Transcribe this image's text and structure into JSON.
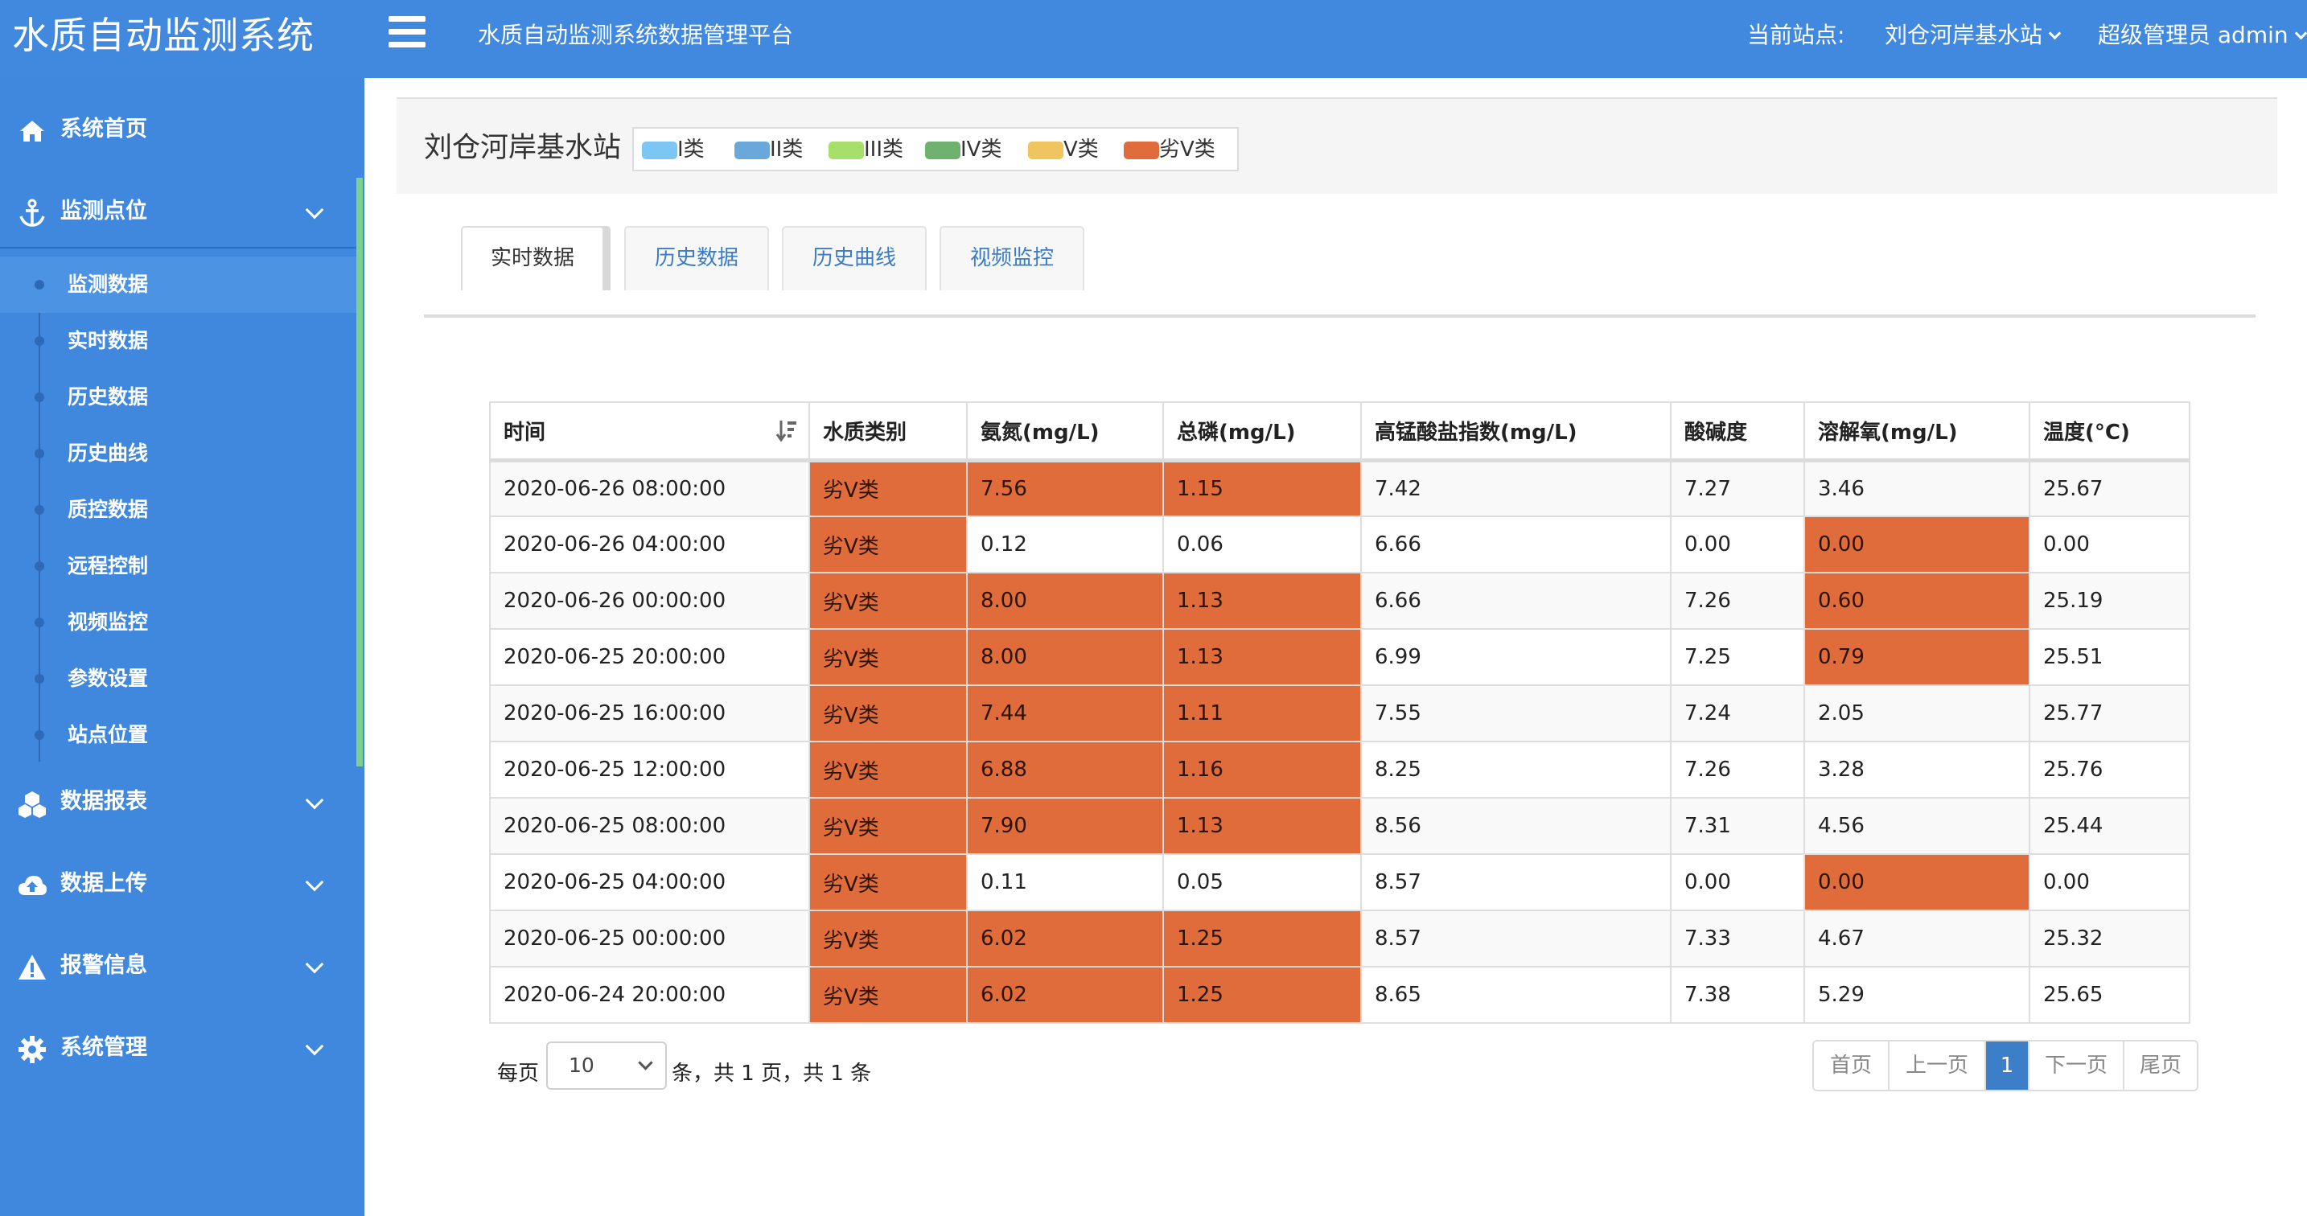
{
  "app": {
    "brand": "水质自动监测系统",
    "platform": "水质自动监测系统数据管理平台",
    "current_site_label": "当前站点:",
    "current_site": "刘仓河岸基水站",
    "user": "超级管理员 admin"
  },
  "sidebar": {
    "menu": [
      {
        "label": "系统首页",
        "icon": "home-icon"
      },
      {
        "label": "监测点位",
        "icon": "anchor-icon"
      },
      {
        "label": "数据报表",
        "icon": "cubes-icon"
      },
      {
        "label": "数据上传",
        "icon": "cloud-upload-icon"
      },
      {
        "label": "报警信息",
        "icon": "warning-icon"
      },
      {
        "label": "系统管理",
        "icon": "gear-icon"
      }
    ],
    "sub_items": [
      "监测数据",
      "实时数据",
      "历史数据",
      "历史曲线",
      "质控数据",
      "远程控制",
      "视频监控",
      "参数设置",
      "站点位置"
    ],
    "active_sub": "监测数据"
  },
  "station": {
    "title": "刘仓河岸基水站",
    "legend": [
      {
        "label": "I类",
        "color": "#7cc6f3"
      },
      {
        "label": "II类",
        "color": "#6aa8dc"
      },
      {
        "label": "III类",
        "color": "#a6e06a"
      },
      {
        "label": "IV类",
        "color": "#6fb26f"
      },
      {
        "label": "V类",
        "color": "#f0c560"
      },
      {
        "label": "劣V类",
        "color": "#e06c3c"
      }
    ]
  },
  "tabs": [
    "实时数据",
    "历史数据",
    "历史曲线",
    "视频监控"
  ],
  "active_tab": "实时数据",
  "table": {
    "headers": [
      "时间",
      "水质类别",
      "氨氮(mg/L)",
      "总磷(mg/L)",
      "高锰酸盐指数(mg/L)",
      "酸碱度",
      "溶解氧(mg/L)",
      "温度(°C)"
    ],
    "highlight_color": "#e06c3c",
    "rows": [
      {
        "cells": [
          "2020-06-26 08:00:00",
          "劣V类",
          "7.56",
          "1.15",
          "7.42",
          "7.27",
          "3.46",
          "25.67"
        ],
        "hl": [
          1,
          2,
          3
        ]
      },
      {
        "cells": [
          "2020-06-26 04:00:00",
          "劣V类",
          "0.12",
          "0.06",
          "6.66",
          "0.00",
          "0.00",
          "0.00"
        ],
        "hl": [
          1,
          6
        ]
      },
      {
        "cells": [
          "2020-06-26 00:00:00",
          "劣V类",
          "8.00",
          "1.13",
          "6.66",
          "7.26",
          "0.60",
          "25.19"
        ],
        "hl": [
          1,
          2,
          3,
          6
        ]
      },
      {
        "cells": [
          "2020-06-25 20:00:00",
          "劣V类",
          "8.00",
          "1.13",
          "6.99",
          "7.25",
          "0.79",
          "25.51"
        ],
        "hl": [
          1,
          2,
          3,
          6
        ]
      },
      {
        "cells": [
          "2020-06-25 16:00:00",
          "劣V类",
          "7.44",
          "1.11",
          "7.55",
          "7.24",
          "2.05",
          "25.77"
        ],
        "hl": [
          1,
          2,
          3
        ]
      },
      {
        "cells": [
          "2020-06-25 12:00:00",
          "劣V类",
          "6.88",
          "1.16",
          "8.25",
          "7.26",
          "3.28",
          "25.76"
        ],
        "hl": [
          1,
          2,
          3
        ]
      },
      {
        "cells": [
          "2020-06-25 08:00:00",
          "劣V类",
          "7.90",
          "1.13",
          "8.56",
          "7.31",
          "4.56",
          "25.44"
        ],
        "hl": [
          1,
          2,
          3
        ]
      },
      {
        "cells": [
          "2020-06-25 04:00:00",
          "劣V类",
          "0.11",
          "0.05",
          "8.57",
          "0.00",
          "0.00",
          "0.00"
        ],
        "hl": [
          1,
          6
        ]
      },
      {
        "cells": [
          "2020-06-25 00:00:00",
          "劣V类",
          "6.02",
          "1.25",
          "8.57",
          "7.33",
          "4.67",
          "25.32"
        ],
        "hl": [
          1,
          2,
          3
        ]
      },
      {
        "cells": [
          "2020-06-24 20:00:00",
          "劣V类",
          "6.02",
          "1.25",
          "8.65",
          "7.38",
          "5.29",
          "25.65"
        ],
        "hl": [
          1,
          2,
          3
        ]
      }
    ]
  },
  "pagination": {
    "per_page_label": "每页",
    "per_page_value": "10",
    "summary": "条，共 1 页，共 1 条",
    "buttons": [
      "首页",
      "上一页",
      "1",
      "下一页",
      "尾页"
    ],
    "current_page": "1"
  }
}
